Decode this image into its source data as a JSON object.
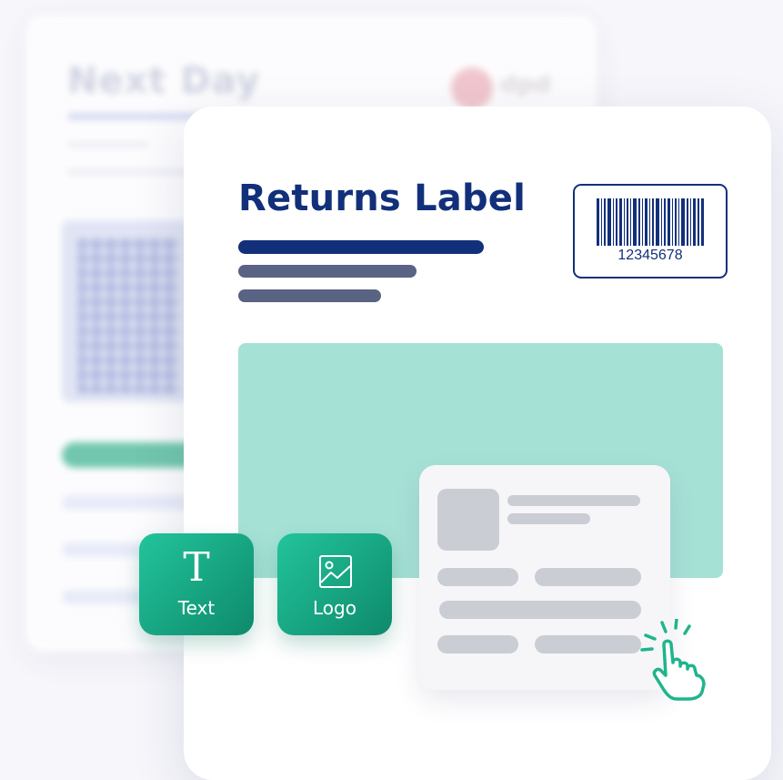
{
  "background_label": {
    "title": "Next Day",
    "carrier_logo_text": "dpd"
  },
  "main_label": {
    "title": "Returns Label",
    "barcode_number": "12345678"
  },
  "tools": {
    "text_tile": {
      "glyph": "T",
      "label": "Text",
      "icon": "text-tool-icon"
    },
    "logo_tile": {
      "label": "Logo",
      "icon": "image-icon"
    }
  },
  "cursor": {
    "icon": "pointing-hand-click-icon"
  },
  "colors": {
    "navy": "#12307a",
    "slate": "#596383",
    "teal_area": "#a6e1d6",
    "tile_start": "#22c49c",
    "tile_end": "#0e8a6b",
    "placeholder_gray": "#cbcdd4"
  }
}
